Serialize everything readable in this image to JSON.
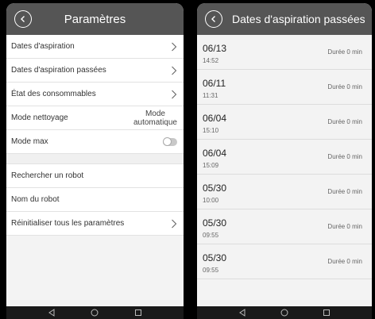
{
  "left": {
    "title": "Paramètres",
    "rows": [
      {
        "label": "Dates d'aspiration"
      },
      {
        "label": "Dates d'aspiration passées"
      },
      {
        "label": "État des consommables"
      },
      {
        "label": "Mode nettoyage",
        "value_line1": "Mode",
        "value_line2": "automatique"
      },
      {
        "label": "Mode max"
      }
    ],
    "rows2": [
      {
        "label": "Rechercher un robot"
      },
      {
        "label": "Nom du robot"
      },
      {
        "label": "Réinitialiser tous les paramètres"
      }
    ],
    "mode_max_enabled": false
  },
  "right": {
    "title": "Dates d'aspiration passées",
    "items": [
      {
        "date": "06/13",
        "time": "14:52",
        "duration": "Durée 0 min"
      },
      {
        "date": "06/11",
        "time": "11:31",
        "duration": "Durée 0 min"
      },
      {
        "date": "06/04",
        "time": "15:10",
        "duration": "Durée 0 min"
      },
      {
        "date": "06/04",
        "time": "15:09",
        "duration": "Durée 0 min"
      },
      {
        "date": "05/30",
        "time": "10:00",
        "duration": "Durée 0 min"
      },
      {
        "date": "05/30",
        "time": "09:55",
        "duration": "Durée 0 min"
      },
      {
        "date": "05/30",
        "time": "09:55",
        "duration": "Durée 0 min"
      }
    ]
  },
  "colors": {
    "topbar": "#555555",
    "navbar": "#1a1a1a",
    "background": "#f3f3f3"
  }
}
